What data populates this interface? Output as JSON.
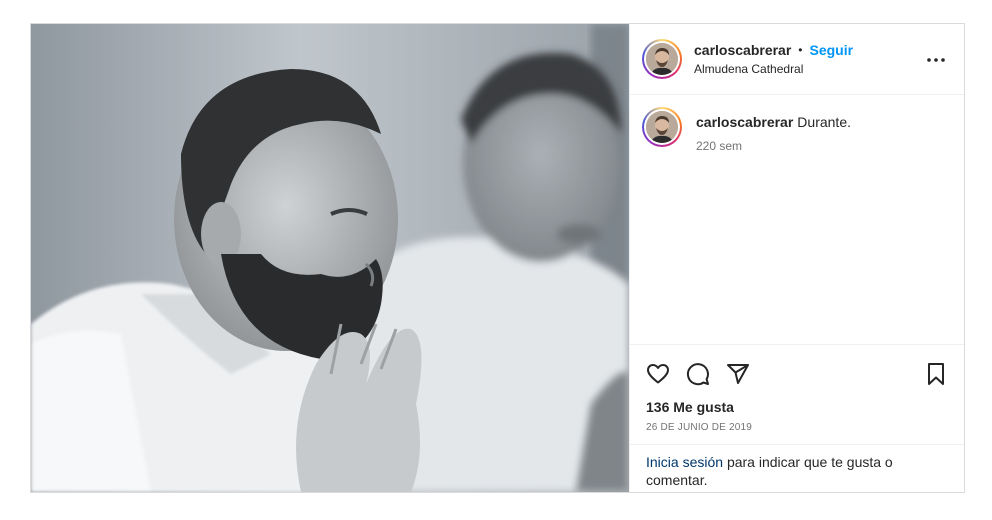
{
  "post": {
    "username": "carloscabrerar",
    "follow_label": "Seguir",
    "separator": "•",
    "location": "Almudena Cathedral",
    "caption": "Durante.",
    "caption_time": "220 sem",
    "likes": "136 Me gusta",
    "date": "26 DE JUNIO DE 2019",
    "login_link": "Inicia sesión",
    "login_rest": "para indicar que te gusta o comentar."
  },
  "icons": {
    "more": "more-options-icon",
    "like": "heart-icon",
    "comment": "comment-icon",
    "share": "share-icon",
    "save": "bookmark-icon"
  },
  "colors": {
    "accent": "#0095f6",
    "link": "#00376b",
    "secondary_text": "#737373",
    "border": "#dbdbdb"
  }
}
